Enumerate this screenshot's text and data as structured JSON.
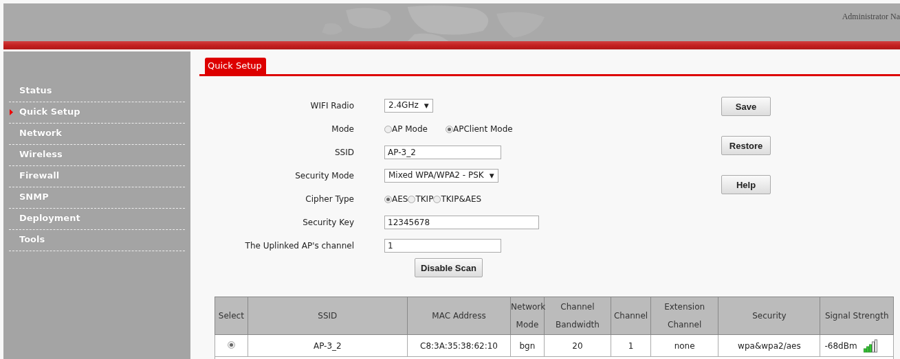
{
  "header": {
    "user_label": "Administrator Na"
  },
  "sidebar": {
    "items": [
      {
        "label": "Status",
        "selected": false
      },
      {
        "label": "Quick Setup",
        "selected": true
      },
      {
        "label": "Network",
        "selected": false
      },
      {
        "label": "Wireless",
        "selected": false
      },
      {
        "label": "Firewall",
        "selected": false
      },
      {
        "label": "SNMP",
        "selected": false
      },
      {
        "label": "Deployment",
        "selected": false
      },
      {
        "label": "Tools",
        "selected": false
      }
    ]
  },
  "tab": {
    "label": "Quick Setup"
  },
  "form": {
    "rows": [
      {
        "label": "WIFI Radio",
        "kind": "select",
        "value": "2.4GHz",
        "arrow": "▼"
      },
      {
        "label": "Mode",
        "kind": "radio",
        "options": [
          {
            "label": "AP Mode",
            "selected": false
          },
          {
            "label": "APClient Mode",
            "selected": true
          }
        ],
        "spaced": true
      },
      {
        "label": "SSID",
        "kind": "text",
        "value": "AP-3_2"
      },
      {
        "label": "Security Mode",
        "kind": "select",
        "value": "Mixed WPA/WPA2 - PSK",
        "arrow": "▼"
      },
      {
        "label": "Cipher Type",
        "kind": "radio",
        "options": [
          {
            "label": "AES",
            "selected": true
          },
          {
            "label": "TKIP",
            "selected": false
          },
          {
            "label": "TKIP&AES",
            "selected": false
          }
        ],
        "spaced": false
      },
      {
        "label": "Security Key",
        "kind": "text",
        "value": "12345678",
        "wide": true
      },
      {
        "label": "The Uplinked AP's channel",
        "kind": "text",
        "value": "1"
      }
    ],
    "scan_button": "Disable Scan"
  },
  "actions": [
    "Save",
    "Restore",
    "Help"
  ],
  "table": {
    "columns": [
      "Select",
      "SSID",
      "MAC Address",
      "Network Mode",
      "Channel Bandwidth",
      "Channel",
      "Extension Channel",
      "Security",
      "Signal Strength"
    ],
    "rows": [
      {
        "selected": true,
        "ssid": "AP-3_2",
        "mac": "C8:3A:35:38:62:10",
        "network_mode": "bgn",
        "bandwidth": "20",
        "channel": "1",
        "extension_channel": "none",
        "security": "wpa&wpa2/aes",
        "signal": "-68dBm"
      }
    ]
  }
}
